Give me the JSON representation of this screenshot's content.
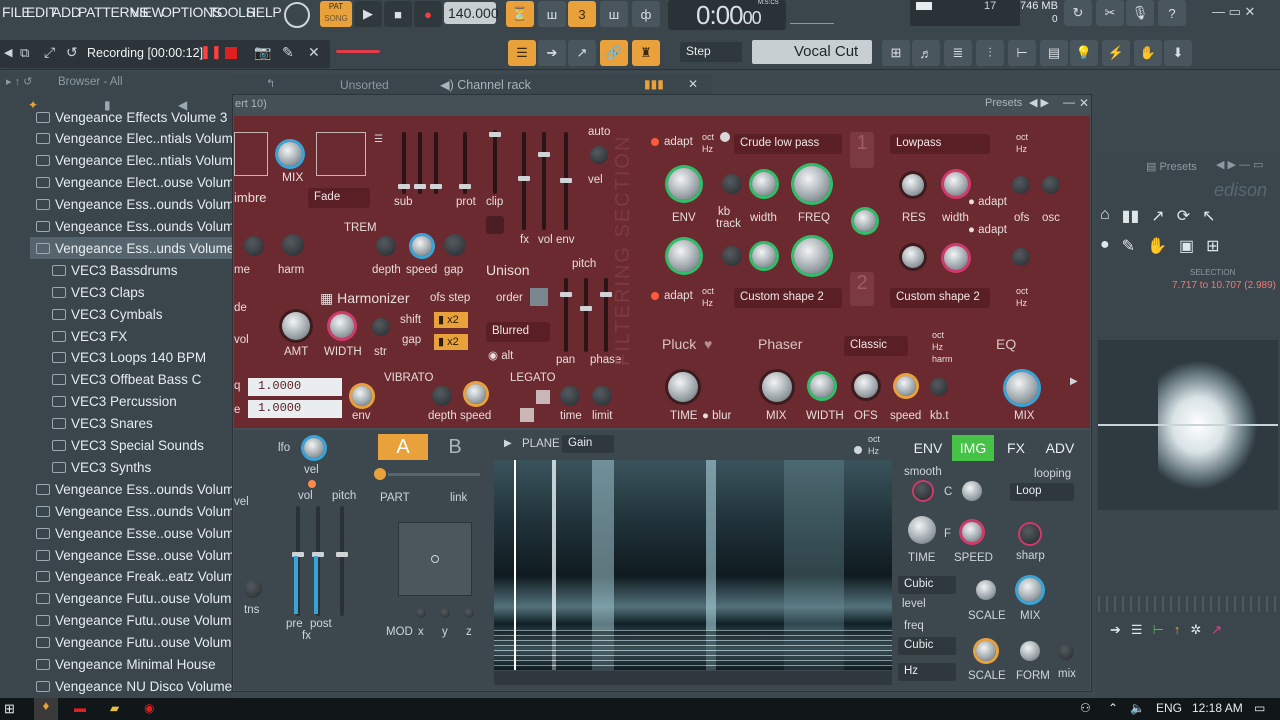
{
  "menu": [
    "FILE",
    "EDIT",
    "ADD",
    "PATTERNS",
    "VIEW",
    "OPTIONS",
    "TOOLS",
    "HELP"
  ],
  "transport": {
    "pat_label": "PAT",
    "song_label": "SONG",
    "tempo": "140.000",
    "time": "0:00",
    "time_small": "00",
    "time_unit": "M:S:CS",
    "cpu_value": "17",
    "memory": "746 MB",
    "mem_small": "0"
  },
  "toolbar2": {
    "step_label": "Step",
    "preset_name": "Vocal Cut"
  },
  "recording": {
    "label": "Recording [00:00:12]"
  },
  "browser": {
    "header": "Browser - All",
    "items": [
      {
        "label": "Vengeance Effects Volume 3",
        "sub": false
      },
      {
        "label": "Vengeance Elec..ntials Volume 1",
        "sub": false
      },
      {
        "label": "Vengeance Elec..ntials Volume 2",
        "sub": false
      },
      {
        "label": "Vengeance Elect..ouse Volume 3",
        "sub": false
      },
      {
        "label": "Vengeance Ess..ounds Volume 1",
        "sub": false
      },
      {
        "label": "Vengeance Ess..ounds Volume 2",
        "sub": false
      },
      {
        "label": "Vengeance Ess..unds Volume 3",
        "sub": false,
        "selected": true
      },
      {
        "label": "VEC3 Bassdrums",
        "sub": true
      },
      {
        "label": "VEC3 Claps",
        "sub": true
      },
      {
        "label": "VEC3 Cymbals",
        "sub": true
      },
      {
        "label": "VEC3 FX",
        "sub": true
      },
      {
        "label": "VEC3 Loops 140 BPM",
        "sub": true
      },
      {
        "label": "VEC3 Offbeat Bass C",
        "sub": true
      },
      {
        "label": "VEC3 Percussion",
        "sub": true
      },
      {
        "label": "VEC3 Snares",
        "sub": true
      },
      {
        "label": "VEC3 Special Sounds",
        "sub": true
      },
      {
        "label": "VEC3 Synths",
        "sub": true
      },
      {
        "label": "Vengeance Ess..ounds Volume 4",
        "sub": false
      },
      {
        "label": "Vengeance Ess..ounds Volume 5",
        "sub": false
      },
      {
        "label": "Vengeance Esse..ouse Volume 1",
        "sub": false
      },
      {
        "label": "Vengeance Esse..ouse Volume 2",
        "sub": false
      },
      {
        "label": "Vengeance Freak..eatz Volume 1",
        "sub": false
      },
      {
        "label": "Vengeance Futu..ouse Volume 1",
        "sub": false
      },
      {
        "label": "Vengeance Futu..ouse Volume 2",
        "sub": false
      },
      {
        "label": "Vengeance Futu..ouse Volume 3",
        "sub": false
      },
      {
        "label": "Vengeance Minimal House",
        "sub": false
      },
      {
        "label": "Vengeance NU Disco Volume 1",
        "sub": false
      }
    ]
  },
  "tabs": {
    "unsorted": "Unsorted",
    "channel_rack": "Channel rack",
    "insert": "ert 10)",
    "presets": "Presets",
    "presets2": "Presets",
    "edison": "edison"
  },
  "synth": {
    "timbre": "imbre",
    "mix": "MIX",
    "fade": "Fade",
    "sub": "sub",
    "prot": "prot",
    "clip": "clip",
    "auto": "auto",
    "fx": "fx",
    "vol": "vol",
    "env": "env",
    "vel": "vel",
    "trem": "TREM",
    "harm": "harm",
    "depth": "depth",
    "speed": "speed",
    "gap": "gap",
    "me": "me",
    "unison": "Unison",
    "pitch": "pitch",
    "order": "order",
    "blurred": "Blurred",
    "alt": "alt",
    "pan": "pan",
    "phase": "phase",
    "harmonizer": "Harmonizer",
    "ofs_step": "ofs step",
    "shift": "shift",
    "gap2": "gap",
    "x2a": "x2",
    "x2b": "x2",
    "amt": "AMT",
    "width": "WIDTH",
    "str": "str",
    "de": "de",
    "vol2": "vol",
    "vibrato": "VIBRATO",
    "legato": "LEGATO",
    "env2": "env",
    "depth2": "depth",
    "speed2": "speed",
    "time": "time",
    "limit": "limit",
    "val1": "1.0000",
    "val2": "1.0000",
    "q": "q",
    "e": "e",
    "adapt1": "adapt",
    "oct": "oct",
    "hz": "Hz",
    "filter1": "Crude low pass",
    "env_label": "ENV",
    "kb_track": "kb",
    "kb_track2": "track",
    "width2": "width",
    "freq": "FREQ",
    "filter_type": "Lowpass",
    "res": "RES",
    "width3": "width",
    "adapt2": "adapt",
    "adapt3": "adapt",
    "ofs": "ofs",
    "osc": "osc",
    "adapt4": "adapt",
    "filter2": "Custom shape 2",
    "filter3": "Custom shape 2",
    "num1": "1",
    "num2": "2",
    "filtering": "FILTERING SECTION",
    "pluck": "Pluck",
    "time2": "TIME",
    "blur": "blur",
    "phaser": "Phaser",
    "classic": "Classic",
    "harm2": "harm",
    "mix2": "MIX",
    "width4": "WIDTH",
    "ofs2": "OFS",
    "speed3": "speed",
    "kbt": "kb.t",
    "eq": "EQ",
    "mix3": "MIX"
  },
  "lower": {
    "lfo": "lfo",
    "vel": "vel",
    "vol": "vol",
    "pitch": "pitch",
    "a": "A",
    "b": "B",
    "part": "PART",
    "link": "link",
    "tns": "tns",
    "pre": "pre",
    "post": "post",
    "fx": "fx",
    "mod": "MOD",
    "x": "x",
    "y": "y",
    "z": "z",
    "vel2": "vel",
    "plane": "PLANE",
    "gain": "Gain",
    "oct": "oct",
    "hz": "Hz"
  },
  "right_tabs": {
    "env": "ENV",
    "img": "IMG",
    "fx": "FX",
    "adv": "ADV"
  },
  "right": {
    "smooth": "smooth",
    "looping": "looping",
    "loop": "Loop",
    "c": "C",
    "f": "F",
    "time": "TIME",
    "speed": "SPEED",
    "sharp": "sharp",
    "cubic1": "Cubic",
    "level": "level",
    "scale": "SCALE",
    "mix": "MIX",
    "freq": "freq",
    "cubic2": "Cubic",
    "hz": "Hz",
    "scale2": "SCALE",
    "form": "FORM",
    "mix2": "mix"
  },
  "edison": {
    "selection": "SELECTION",
    "range": "7.717 to 10.707 (2.989)"
  },
  "taskbar": {
    "lang": "ENG",
    "time": "12:18 AM"
  }
}
